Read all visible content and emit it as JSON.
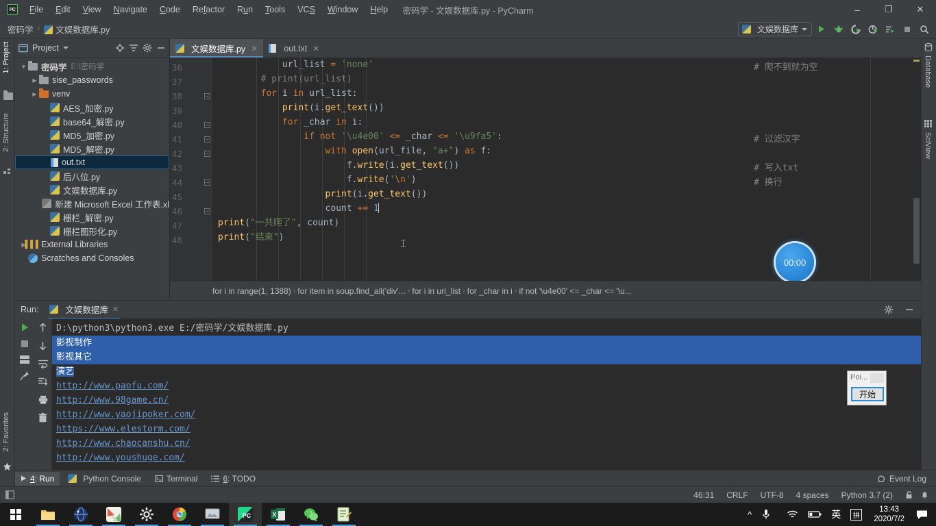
{
  "window": {
    "title": "密码学 - 文娱数据库.py - PyCharm",
    "minimize": "–",
    "maximize": "❐",
    "close": "✕"
  },
  "menu": [
    {
      "label": "File"
    },
    {
      "label": "Edit"
    },
    {
      "label": "View"
    },
    {
      "label": "Navigate"
    },
    {
      "label": "Code"
    },
    {
      "label": "Refactor"
    },
    {
      "label": "Run"
    },
    {
      "label": "Tools"
    },
    {
      "label": "VCS"
    },
    {
      "label": "Window"
    },
    {
      "label": "Help"
    }
  ],
  "navbar": {
    "crumb_project": "密码学",
    "crumb_file": "文娱数据库.py",
    "separator": "›",
    "run_config": "文娱数据库"
  },
  "left_strip": {
    "project_tab": "1: Project",
    "structure_tab": "2: Structure",
    "favorites_tab": "2: Favorites"
  },
  "right_strip": {
    "database_tab": "Database",
    "sciview_tab": "SciView"
  },
  "project": {
    "title": "Project",
    "tree": [
      {
        "label": "密码学",
        "path": "E:\\密码学",
        "icon": "folder",
        "arrow": "▼",
        "indent": 0,
        "bold": true,
        "selected": false
      },
      {
        "label": "sise_passwords",
        "path": "",
        "icon": "folder",
        "arrow": "▶",
        "indent": 1,
        "bold": false,
        "selected": false
      },
      {
        "label": "venv",
        "path": "",
        "icon": "folder-orange",
        "arrow": "▶",
        "indent": 1,
        "bold": false,
        "selected": false
      },
      {
        "label": "AES_加密.py",
        "path": "",
        "icon": "python",
        "arrow": "",
        "indent": 2,
        "bold": false,
        "selected": false
      },
      {
        "label": "base64_解密.py",
        "path": "",
        "icon": "python",
        "arrow": "",
        "indent": 2,
        "bold": false,
        "selected": false
      },
      {
        "label": "MD5_加密.py",
        "path": "",
        "icon": "python",
        "arrow": "",
        "indent": 2,
        "bold": false,
        "selected": false
      },
      {
        "label": "MD5_解密.py",
        "path": "",
        "icon": "python",
        "arrow": "",
        "indent": 2,
        "bold": false,
        "selected": false
      },
      {
        "label": "out.txt",
        "path": "",
        "icon": "text",
        "arrow": "",
        "indent": 2,
        "bold": false,
        "selected": true
      },
      {
        "label": "后八位.py",
        "path": "",
        "icon": "python",
        "arrow": "",
        "indent": 2,
        "bold": false,
        "selected": false
      },
      {
        "label": "文娱数据库.py",
        "path": "",
        "icon": "python",
        "arrow": "",
        "indent": 2,
        "bold": false,
        "selected": false
      },
      {
        "label": "新建 Microsoft Excel 工作表.xl",
        "path": "",
        "icon": "excel",
        "arrow": "",
        "indent": 2,
        "bold": false,
        "selected": false
      },
      {
        "label": "栅栏_解密.py",
        "path": "",
        "icon": "python",
        "arrow": "",
        "indent": 2,
        "bold": false,
        "selected": false
      },
      {
        "label": "栅栏图形化.py",
        "path": "",
        "icon": "python",
        "arrow": "",
        "indent": 2,
        "bold": false,
        "selected": false
      },
      {
        "label": "External Libraries",
        "path": "",
        "icon": "library",
        "arrow": "▶",
        "indent": 0,
        "bold": false,
        "selected": false
      },
      {
        "label": "Scratches and Consoles",
        "path": "",
        "icon": "scratch",
        "arrow": "",
        "indent": 0,
        "bold": false,
        "selected": false
      }
    ]
  },
  "editor": {
    "tabs": [
      {
        "label": "文娱数据库.py",
        "icon": "python",
        "active": true,
        "close": "✕"
      },
      {
        "label": "out.txt",
        "icon": "text",
        "active": false,
        "close": "✕"
      }
    ],
    "first_line_number": 36,
    "lines": [
      {
        "n": 36,
        "fold": false,
        "html": "            <span class=\"ident\">url_list</span> <span class=\"kw\">=</span> <span class=\"str\">'none'</span>"
      },
      {
        "n": 37,
        "fold": false,
        "html": "        <span class=\"cm\"># print(url_list)</span>"
      },
      {
        "n": 38,
        "fold": true,
        "html": "        <span class=\"kw\">for</span> <span class=\"ident\">i</span> <span class=\"kw\">in</span> <span class=\"ident\">url_list</span>:"
      },
      {
        "n": 39,
        "fold": false,
        "html": "            <span class=\"fn\">print</span>(<span class=\"ident\">i</span>.<span class=\"fn\">get_text</span>())"
      },
      {
        "n": 40,
        "fold": true,
        "html": "            <span class=\"kw\">for</span> <span class=\"ident\">_char</span> <span class=\"kw\">in</span> <span class=\"ident\">i</span>:"
      },
      {
        "n": 41,
        "fold": true,
        "html": "                <span class=\"kw\">if not</span> <span class=\"str\">'\\u4e00'</span> <span class=\"kw\">&lt;=</span> <span class=\"ident\">_char</span> <span class=\"kw\">&lt;=</span> <span class=\"str\">'\\u9fa5'</span>:"
      },
      {
        "n": 42,
        "fold": true,
        "html": "                    <span class=\"kw\">with</span> <span class=\"fn\">open</span>(<span class=\"ident\">url_file</span>, <span class=\"str\">\"a+\"</span>) <span class=\"kw\">as</span> <span class=\"ident\">f</span>:"
      },
      {
        "n": 43,
        "fold": false,
        "html": "                        <span class=\"ident\">f</span>.<span class=\"fn\">write</span>(<span class=\"ident\">i</span>.<span class=\"fn\">get_text</span>())"
      },
      {
        "n": 44,
        "fold": true,
        "html": "                        <span class=\"ident\">f</span>.<span class=\"fn\">write</span>(<span class=\"str\">'</span><span class=\"strk\">\\n</span><span class=\"str\">'</span>)"
      },
      {
        "n": 45,
        "fold": false,
        "html": "                    <span class=\"fn\">print</span>(<span class=\"ident\">i</span>.<span class=\"fn\">get_text</span>())"
      },
      {
        "n": 46,
        "fold": true,
        "html": "                    <span class=\"ident\">count</span> <span class=\"kw\">+=</span> <span class=\"num\">1</span><span class=\"caret-bar\"></span>"
      },
      {
        "n": 47,
        "fold": false,
        "html": "<span class=\"fn\">print</span>(<span class=\"str\">\"一共爬了\"</span>, <span class=\"ident\">count</span>)"
      },
      {
        "n": 48,
        "fold": false,
        "html": "<span class=\"fn\">print</span>(<span class=\"str\">\"结束\"</span>)"
      }
    ],
    "right_comments": [
      {
        "line": 36,
        "text": "# 爬不到就为空"
      },
      {
        "line": 41,
        "text": "# 过滤汉字"
      },
      {
        "line": 43,
        "text": "# 写入txt"
      },
      {
        "line": 44,
        "text": "# 换行"
      }
    ],
    "timer_value": "00:00"
  },
  "breadcrumbs": [
    "for i in range(1, 1388)",
    "for item in soup.find_all('div'...",
    "for i in url_list",
    "for _char in i",
    "if not '\\u4e00' <= _char <= '\\u..."
  ],
  "breadcrumb_separator": "›",
  "run_panel": {
    "label": "Run:",
    "tab_title": "文娱数据库",
    "tab_close": "✕",
    "output": [
      {
        "text": "D:\\python3\\python3.exe E:/密码学/文娱数据库.py",
        "type": "plain",
        "highlight": false
      },
      {
        "text": "影视制作",
        "type": "plain",
        "highlight": true
      },
      {
        "text": "影视其它",
        "type": "plain",
        "highlight": true
      },
      {
        "text": "演艺",
        "type": "plain",
        "highlight": "partial"
      },
      {
        "text": "http://www.paofu.com/",
        "type": "link",
        "highlight": false
      },
      {
        "text": "http://www.98game.cn/",
        "type": "link",
        "highlight": false
      },
      {
        "text": "http://www.yaojipoker.com/",
        "type": "link",
        "highlight": false
      },
      {
        "text": "https://www.elestorm.com/",
        "type": "link",
        "highlight": false
      },
      {
        "text": "http://www.chaocanshu.cn/",
        "type": "link",
        "highlight": false
      },
      {
        "text": "http://www.youshuge.com/",
        "type": "link",
        "highlight": false
      }
    ]
  },
  "popup": {
    "title": "Poi...",
    "button": "开始"
  },
  "tool_tabs": [
    {
      "label": "4: Run",
      "mnemonic": "4",
      "icon": "run-triangle-icon",
      "active": true
    },
    {
      "label": "Python Console",
      "mnemonic": "",
      "icon": "python-icon",
      "active": false
    },
    {
      "label": "Terminal",
      "mnemonic": "",
      "icon": "terminal-icon",
      "active": false
    },
    {
      "label": "6: TODO",
      "mnemonic": "6",
      "icon": "todo-icon",
      "active": false
    }
  ],
  "event_log": "Event Log",
  "statusbar": {
    "position": "46:31",
    "line_ending": "CRLF",
    "encoding": "UTF-8",
    "indent": "4 spaces",
    "interpreter": "Python 3.7 (2)"
  },
  "taskbar": {
    "apps": [
      {
        "name": "file-explorer",
        "color": "#e8b53f"
      },
      {
        "name": "network-app",
        "color": "#203a6e"
      },
      {
        "name": "paint-app",
        "color": "#e8e0d0"
      },
      {
        "name": "settings-gear",
        "color": "#d8d8d8"
      },
      {
        "name": "chrome-browser",
        "color": "#49a94e"
      },
      {
        "name": "screenshot-tool",
        "color": "#c9cdd2"
      },
      {
        "name": "pycharm",
        "color": "#2ecc71",
        "active": true
      },
      {
        "name": "excel",
        "color": "#1d7044"
      },
      {
        "name": "wechat",
        "color": "#4ec34e"
      },
      {
        "name": "notepad-app",
        "color": "#d8e8c0"
      }
    ],
    "tray": {
      "chevron": "^",
      "mic": "mic-icon",
      "wifi": "wifi-icon",
      "battery": "battery-icon",
      "ime_lang": "英",
      "ime_mode": "拼",
      "time": "13:43",
      "date": "2020/7/2",
      "notifications": "notification-icon"
    }
  }
}
